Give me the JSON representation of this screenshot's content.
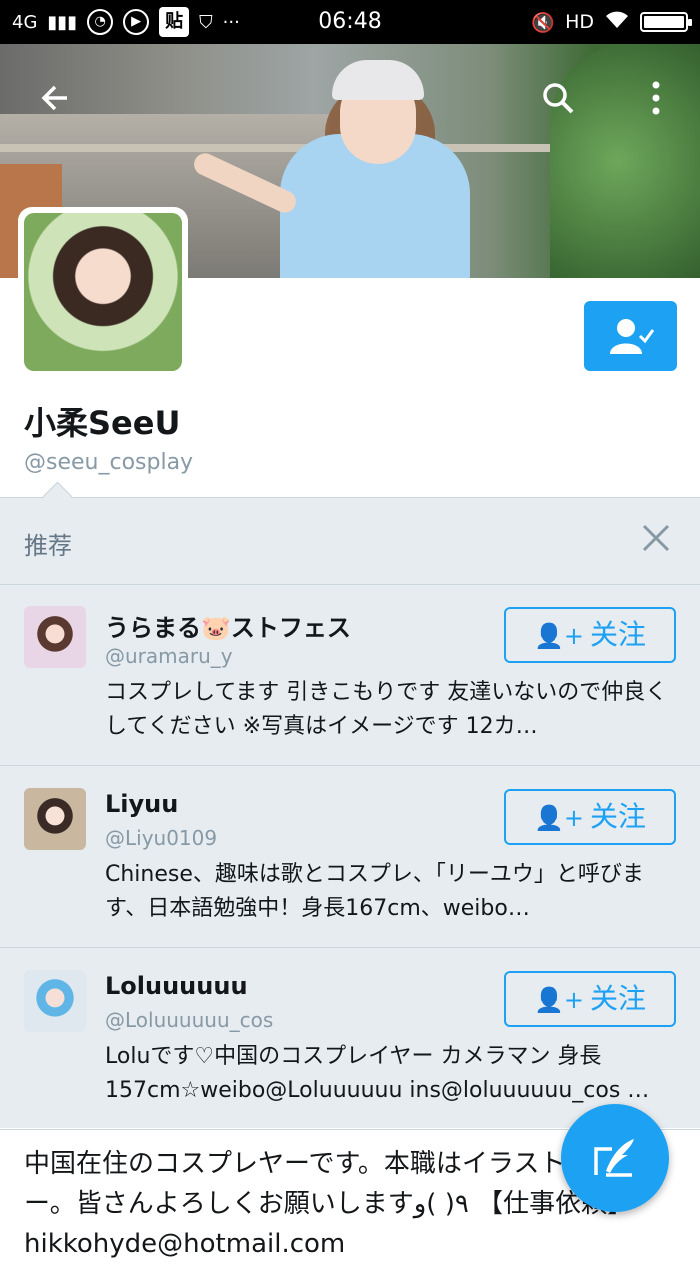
{
  "status_bar": {
    "network": "4G",
    "time": "06:48",
    "hd_label": "HD",
    "tieba_label": "贴",
    "more_dots": "···"
  },
  "profile": {
    "display_name": "小柔SeeU",
    "handle": "@seeu_cosplay",
    "bio": "中国在住のコスプレヤーです。本職はイラストレーター。皆さんよろしくお願いします٩( )و 【仕事依頼】hikkohyde@hotmail.com"
  },
  "recommend": {
    "title": "推荐",
    "follow_label": "关注",
    "accounts": [
      {
        "name": "うらまる🐷ストフェス",
        "handle": "@uramaru_y",
        "bio": "コスプレしてます 引きこもりです 友達いないので仲良くしてください ※写真はイメージです 12カ…"
      },
      {
        "name": "Liyuu",
        "handle": "@Liyu0109",
        "bio": "Chinese、趣味は歌とコスプレ、「リーユウ」と呼びます、日本語勉強中！身長167cm、weibo…"
      },
      {
        "name": "Loluuuuuu",
        "handle": "@Loluuuuuu_cos",
        "bio": "Loluです♡中国のコスプレイヤー カメラマン 身長157cm☆weibo@Loluuuuuu ins@loluuuuuu_cos …"
      }
    ]
  },
  "icons": {
    "back": "back-arrow-icon",
    "search": "search-icon",
    "more": "more-vertical-icon",
    "compose": "compose-tweet-icon",
    "close": "close-icon"
  },
  "colors": {
    "accent": "#1da1f2",
    "recommend_bg": "#e6ecf0",
    "secondary_text": "#8899a6"
  }
}
